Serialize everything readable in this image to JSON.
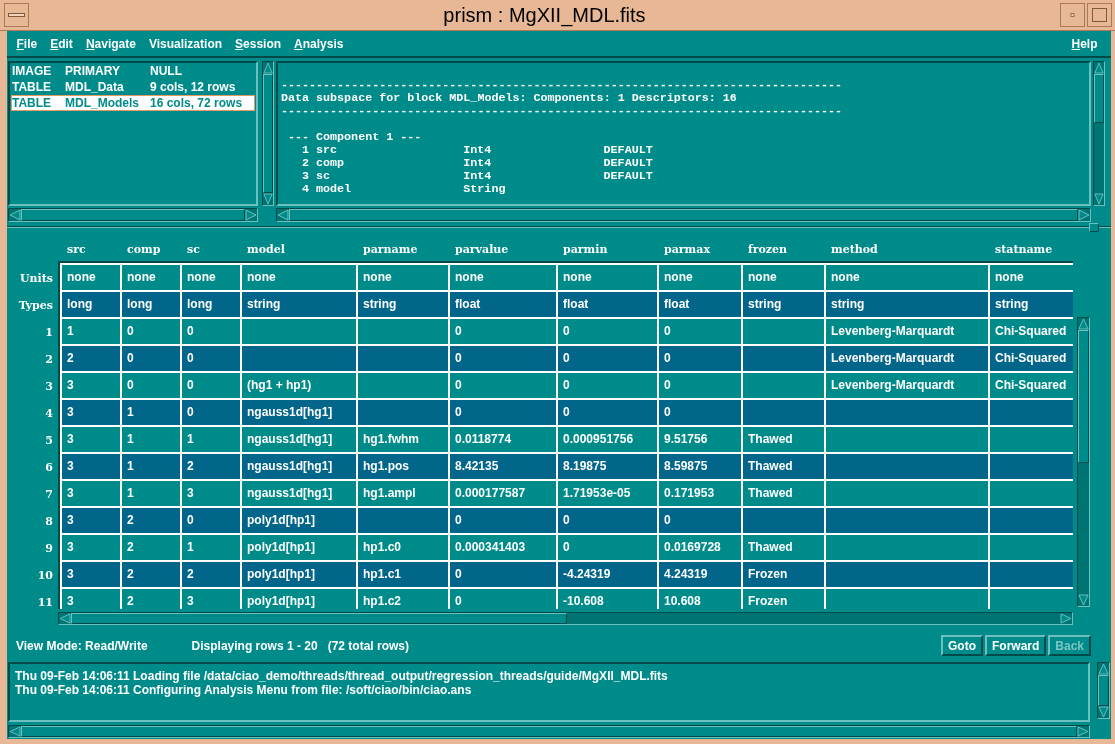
{
  "window": {
    "title": "prism : MgXII_MDL.fits"
  },
  "menu_bar": {
    "items": [
      {
        "label": "File",
        "mnemonic": true
      },
      {
        "label": "Edit",
        "mnemonic": true
      },
      {
        "label": "Navigate",
        "mnemonic": true
      },
      {
        "label": "Visualization",
        "mnemonic": false
      },
      {
        "label": "Session",
        "mnemonic": true
      },
      {
        "label": "Analysis",
        "mnemonic": true
      }
    ],
    "help": {
      "label": "Help",
      "mnemonic": true
    }
  },
  "block_list": {
    "items": [
      {
        "type": "IMAGE",
        "name": "PRIMARY",
        "info": "NULL",
        "selected": false
      },
      {
        "type": "TABLE",
        "name": "MDL_Data",
        "info": "9 cols, 12 rows",
        "selected": false
      },
      {
        "type": "TABLE",
        "name": "MDL_Models",
        "info": "16 cols, 72 rows",
        "selected": true
      }
    ]
  },
  "info_pane": {
    "header_lines": [
      "--------------------------------------------------------------------------------",
      "Data subspace for block MDL_Models: Components: 1 Descriptors: 16",
      "--------------------------------------------------------------------------------"
    ],
    "component_title": "--- Component 1 ---",
    "descriptors": [
      {
        "index": "1",
        "name": "src",
        "type": "Int4",
        "default": "DEFAULT"
      },
      {
        "index": "2",
        "name": "comp",
        "type": "Int4",
        "default": "DEFAULT"
      },
      {
        "index": "3",
        "name": "sc",
        "type": "Int4",
        "default": "DEFAULT"
      },
      {
        "index": "4",
        "name": "model",
        "type": "String"
      }
    ]
  },
  "table": {
    "columns": [
      "src",
      "comp",
      "sc",
      "model",
      "parname",
      "parvalue",
      "parmin",
      "parmax",
      "frozen",
      "method",
      "statname"
    ],
    "rows": [
      {
        "label": "Units",
        "cells": [
          "none",
          "none",
          "none",
          "none",
          "none",
          "none",
          "none",
          "none",
          "none",
          "none",
          "none"
        ]
      },
      {
        "label": "Types",
        "cells": [
          "long",
          "long",
          "long",
          "string",
          "string",
          "float",
          "float",
          "float",
          "string",
          "string",
          "string"
        ]
      },
      {
        "label": "1",
        "cells": [
          "1",
          "0",
          "0",
          null,
          null,
          "0",
          "0",
          "0",
          null,
          "Levenberg-Marquardt",
          "Chi-Squared"
        ]
      },
      {
        "label": "2",
        "cells": [
          "2",
          "0",
          "0",
          null,
          null,
          "0",
          "0",
          "0",
          null,
          "Levenberg-Marquardt",
          "Chi-Squared"
        ]
      },
      {
        "label": "3",
        "cells": [
          "3",
          "0",
          "0",
          "(hg1 + hp1)",
          null,
          "0",
          "0",
          "0",
          null,
          "Levenberg-Marquardt",
          "Chi-Squared"
        ]
      },
      {
        "label": "4",
        "cells": [
          "3",
          "1",
          "0",
          "ngauss1d[hg1]",
          null,
          "0",
          "0",
          "0",
          null,
          null,
          null
        ]
      },
      {
        "label": "5",
        "cells": [
          "3",
          "1",
          "1",
          "ngauss1d[hg1]",
          "hg1.fwhm",
          "0.0118774",
          "0.000951756",
          "9.51756",
          "Thawed",
          null,
          null
        ]
      },
      {
        "label": "6",
        "cells": [
          "3",
          "1",
          "2",
          "ngauss1d[hg1]",
          "hg1.pos",
          "8.42135",
          "8.19875",
          "8.59875",
          "Thawed",
          null,
          null
        ]
      },
      {
        "label": "7",
        "cells": [
          "3",
          "1",
          "3",
          "ngauss1d[hg1]",
          "hg1.ampl",
          "0.000177587",
          "1.71953e-05",
          "0.171953",
          "Thawed",
          null,
          null
        ]
      },
      {
        "label": "8",
        "cells": [
          "3",
          "2",
          "0",
          "poly1d[hp1]",
          null,
          "0",
          "0",
          "0",
          null,
          null,
          null
        ]
      },
      {
        "label": "9",
        "cells": [
          "3",
          "2",
          "1",
          "poly1d[hp1]",
          "hp1.c0",
          "0.000341403",
          "0",
          "0.0169728",
          "Thawed",
          null,
          null
        ]
      },
      {
        "label": "10",
        "cells": [
          "3",
          "2",
          "2",
          "poly1d[hp1]",
          "hp1.c1",
          "0",
          "-4.24319",
          "4.24319",
          "Frozen",
          null,
          null
        ]
      },
      {
        "label": "11",
        "cells": [
          "3",
          "2",
          "3",
          "poly1d[hp1]",
          "hp1.c2",
          "0",
          "-10.608",
          "10.608",
          "Frozen",
          null,
          null
        ]
      }
    ]
  },
  "status": {
    "view_mode": "View Mode: Read/Write",
    "rows_info": "Displaying rows 1 - 20   (72 total rows)"
  },
  "buttons": [
    {
      "label": "Goto",
      "disabled": false
    },
    {
      "label": "Forward",
      "disabled": false
    },
    {
      "label": "Back",
      "disabled": true
    }
  ],
  "log": {
    "lines": [
      "Thu 09-Feb 14:06:11 Loading file /data/ciao_demo/threads/thread_output/regression_threads/guide/MgXII_MDL.fits",
      "Thu 09-Feb 14:06:11 Configuring Analysis Menu from file: /soft/ciao/bin/ciao.ans"
    ]
  }
}
